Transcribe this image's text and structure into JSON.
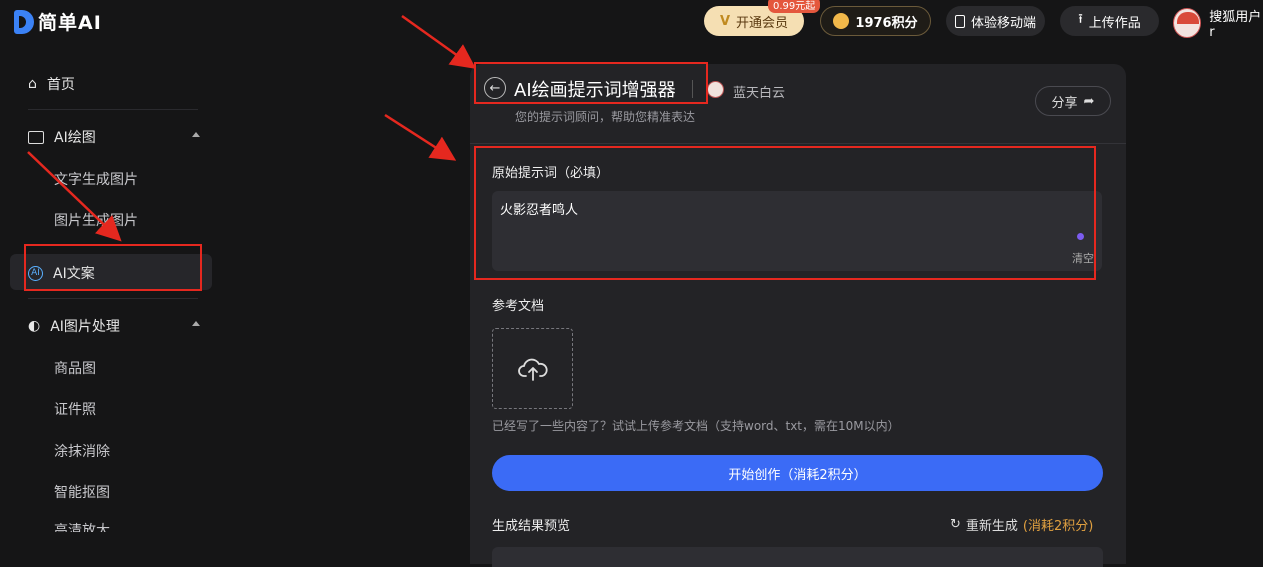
{
  "logo": {
    "text": "简单AI"
  },
  "topbar": {
    "vip_label": "开通会员",
    "vip_badge": "0.99元起",
    "points_label": "1976积分",
    "mobile_label": "体验移动端",
    "upload_label": "上传作品",
    "user_name": "搜狐用户r"
  },
  "sidebar": {
    "home": "首页",
    "ai_draw": "AI绘图",
    "text_to_image": "文字生成图片",
    "image_to_image": "图片生成图片",
    "ai_copy": "AI文案",
    "ai_image_proc": "AI图片处理",
    "product": "商品图",
    "id_photo": "证件照",
    "erase": "涂抹消除",
    "cutout": "智能抠图",
    "partial": "高清放大"
  },
  "panel": {
    "title": "AI绘画提示词增强器",
    "author": "蓝天白云",
    "subtitle": "您的提示词顾问，帮助您精准表达",
    "share": "分享",
    "prompt_label": "原始提示词（必填）",
    "prompt_value": "火影忍者鸣人",
    "clear": "清空",
    "ref_label": "参考文档",
    "ref_hint": "已经写了一些内容了？试试上传参考文档（支持word、txt，需在10M以内）",
    "start_button": "开始创作（消耗2积分）",
    "result_label": "生成结果预览",
    "regen": "重新生成",
    "regen_cost": "(消耗2积分)"
  },
  "colors": {
    "accent": "#3b6bf6",
    "annotation": "#e5281f",
    "vip": "#f5dfb3"
  }
}
